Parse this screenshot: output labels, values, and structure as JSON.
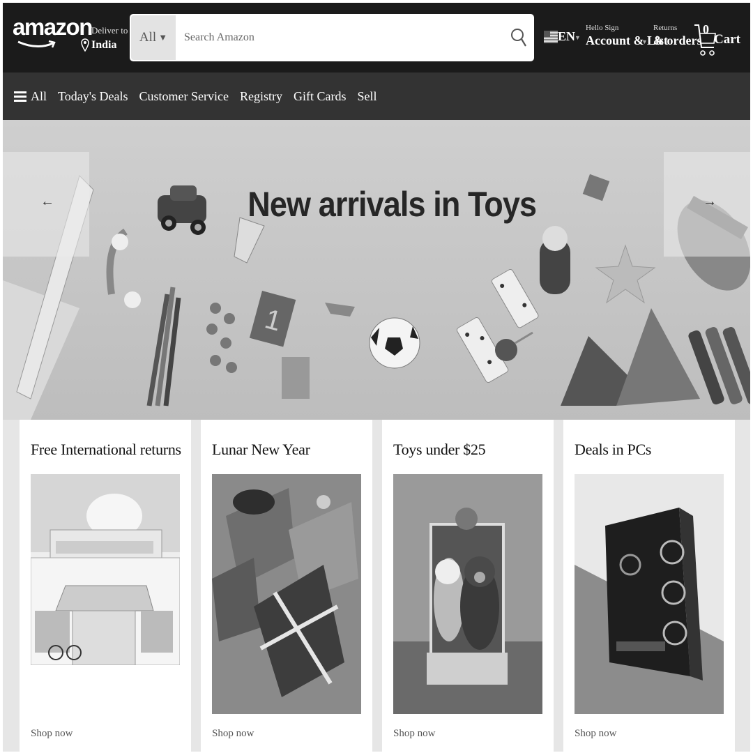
{
  "header": {
    "logo_text": "amazon",
    "deliver_line1": "Deliver to",
    "deliver_line2": "India",
    "search_category": "All",
    "search_placeholder": "Search Amazon",
    "language": "EN",
    "account_line1": "Hello Sign",
    "account_line2": "Account & List",
    "returns_line1": "Returns",
    "returns_line2": "& orders",
    "cart_count": "0",
    "cart_label": "Cart"
  },
  "subnav": {
    "all_label": "All",
    "items": [
      "Today's Deals",
      "Customer Service",
      "Registry",
      "Gift Cards",
      "Sell"
    ]
  },
  "hero": {
    "title": "New arrivals in Toys",
    "prev_arrow": "←",
    "next_arrow": "→"
  },
  "cards": [
    {
      "title": "Free International returns",
      "link": "Shop now",
      "icon": "storefront-illustration"
    },
    {
      "title": "Lunar New Year",
      "link": "Shop now",
      "icon": "gift-boxes-photo"
    },
    {
      "title": "Toys under $25",
      "link": "Shop now",
      "icon": "teddy-bears-photo"
    },
    {
      "title": "Deals in PCs",
      "link": "Shop now",
      "icon": "pc-case-photo"
    }
  ]
}
